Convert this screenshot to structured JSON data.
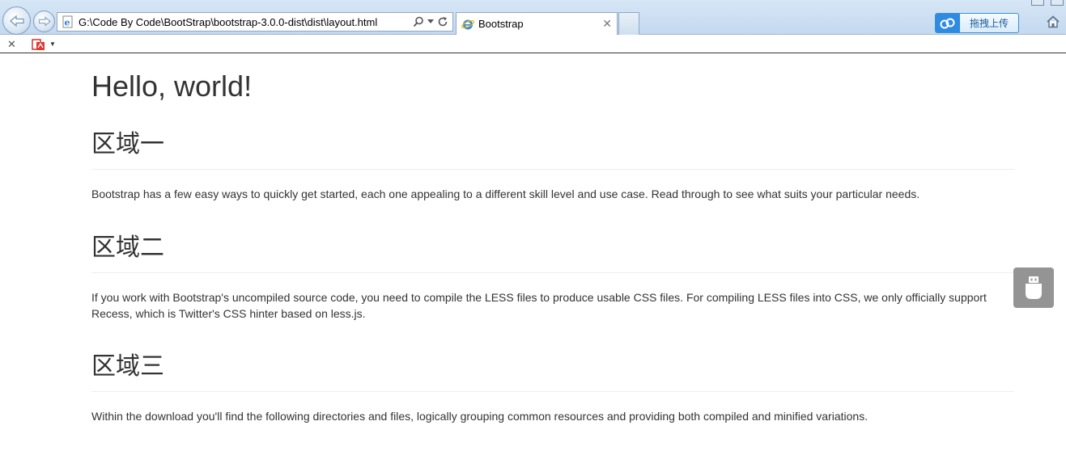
{
  "browser": {
    "address_value": "G:\\Code By Code\\BootStrap\\bootstrap-3.0.0-dist\\dist\\layout.html",
    "tab_title": "Bootstrap",
    "upload_label": "拖拽上传",
    "icons": {
      "back": "back-arrow-icon",
      "forward": "forward-arrow-icon",
      "page": "ie-page-icon",
      "search": "search-icon",
      "refresh": "refresh-icon",
      "home": "home-icon",
      "close": "close-icon",
      "pdf": "pdf-convert-icon"
    },
    "colors": {
      "accent": "#2f8be0",
      "chrome": "#c4d9ef"
    }
  },
  "page": {
    "title": "Hello, world!",
    "sections": [
      {
        "heading": "区域一",
        "body": "Bootstrap has a few easy ways to quickly get started, each one appealing to a different skill level and use case. Read through to see what suits your particular needs."
      },
      {
        "heading": "区域二",
        "body": "If you work with Bootstrap's uncompiled source code, you need to compile the LESS files to produce usable CSS files. For compiling LESS files into CSS, we only officially support Recess, which is Twitter's CSS hinter based on less.js."
      },
      {
        "heading": "区域三",
        "body": "Within the download you'll find the following directories and files, logically grouping common resources and providing both compiled and minified variations."
      }
    ]
  }
}
